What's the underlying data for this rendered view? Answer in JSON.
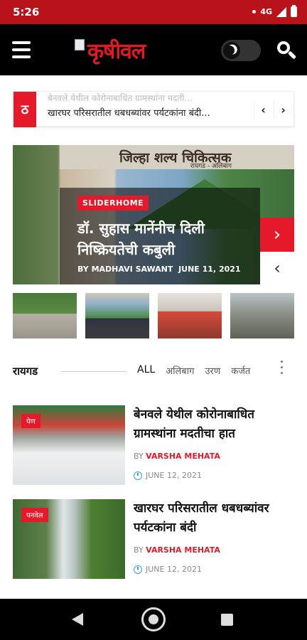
{
  "status_bar": {
    "time": "5:26",
    "network": "4G"
  },
  "app_bar": {
    "logo_text": "कृषीवल"
  },
  "ticker": {
    "badge": "ठ",
    "previous_headline": "बेनवले येथील कोरोनाबाधित ग्रामस्थांना मदती...",
    "headline": "खारघर परिसरातील धबधब्यांवर पर्यटकांना बंदी...",
    "prev_label": "‹",
    "next_label": "›"
  },
  "slider": {
    "banner_text": "जिल्हा शल्य चिकित्सक",
    "banner_sub": "रायगड - अलिबाग",
    "category": "SLIDERHOME",
    "title": "डॉ. सुहास मानेंनीच दिली निष्क्रियतेची कबुली",
    "byline_prefix": "BY",
    "author": "MADHAVI SAWANT",
    "date": "JUNE 11, 2021",
    "next_label": "›",
    "prev_label": "‹"
  },
  "section": {
    "title": "रायगड",
    "tabs": [
      {
        "label": "ALL"
      },
      {
        "label": "अलिबाग"
      },
      {
        "label": "उरण"
      },
      {
        "label": "कर्जत"
      }
    ]
  },
  "articles": [
    {
      "badge": "पेण",
      "title": "बेनवले येथील कोरोनाबाधित ग्रामस्थांना मदतीचा हात",
      "by": "BY",
      "author": "VARSHA MEHATA",
      "date": "JUNE 12, 2021"
    },
    {
      "badge": "पनवेल",
      "title": "खारघर परिसरातील धबधब्यांवर पर्यटकांना बंदी",
      "by": "BY",
      "author": "VARSHA MEHATA",
      "date": "JUNE 12, 2021"
    }
  ],
  "colors": {
    "status_bar": "#b8121b",
    "accent": "#e5192a",
    "app_bar": "#000000",
    "date_icon": "#39a0c9"
  }
}
